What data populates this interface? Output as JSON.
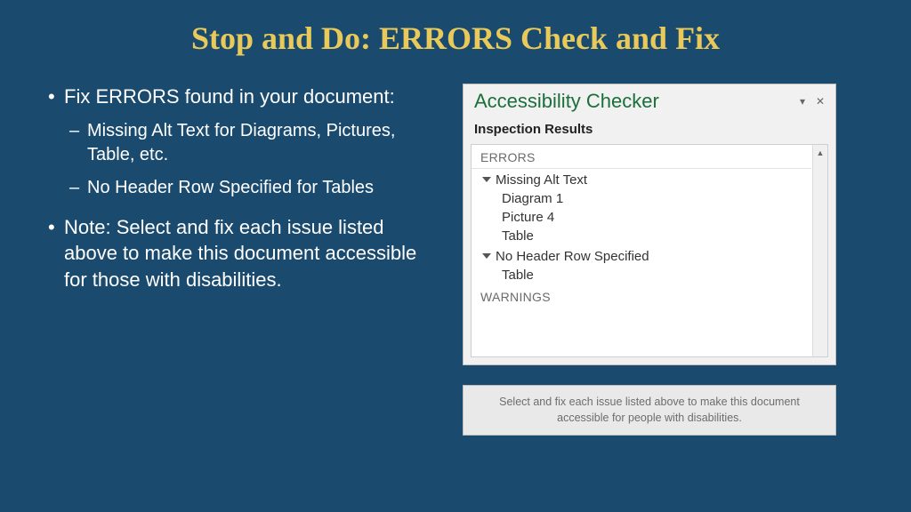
{
  "slide": {
    "title": "Stop and Do: ERRORS Check and Fix",
    "bullets": {
      "b1": "Fix ERRORS found in your document:",
      "b1a": "Missing Alt Text for Diagrams, Pictures, Table, etc.",
      "b1b": "No Header Row Specified for Tables",
      "b2": "Note: Select and fix each issue listed above to make this document accessible for those with disabilities."
    }
  },
  "panel": {
    "title": "Accessibility Checker",
    "section": "Inspection Results",
    "cat_errors": "ERRORS",
    "group1": {
      "header": "Missing Alt Text",
      "items": [
        "Diagram 1",
        "Picture 4",
        "Table"
      ]
    },
    "group2": {
      "header": "No Header Row Specified",
      "items": [
        "Table"
      ]
    },
    "cat_warnings": "WARNINGS"
  },
  "helper": {
    "text": "Select and fix each issue listed above to make this document accessible for people with disabilities."
  }
}
